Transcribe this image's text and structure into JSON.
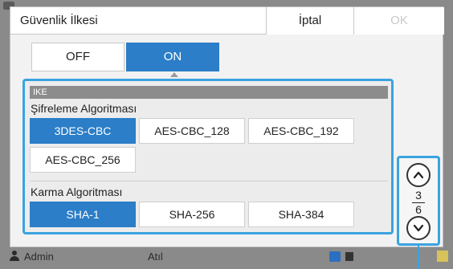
{
  "background": {
    "status_user": "Admin",
    "status_mid": "Atıl"
  },
  "dialog": {
    "title": "Güvenlik İlkesi",
    "cancel_label": "İptal",
    "ok_label": "OK",
    "toggle": {
      "off_label": "OFF",
      "on_label": "ON",
      "selected": "ON"
    }
  },
  "panel": {
    "section_title": "IKE",
    "encryption": {
      "label": "Şifreleme Algoritması",
      "options": [
        "3DES-CBC",
        "AES-CBC_128",
        "AES-CBC_192",
        "AES-CBC_256"
      ],
      "selected": "3DES-CBC"
    },
    "hash": {
      "label": "Karma Algoritması",
      "options": [
        "SHA-1",
        "SHA-256",
        "SHA-384"
      ],
      "selected": "SHA-1"
    }
  },
  "pager": {
    "current": "3",
    "total": "6"
  },
  "colors": {
    "accent": "#2b7ec7",
    "highlight": "#3aa3e0",
    "disabled_text": "#c9c9c9"
  }
}
